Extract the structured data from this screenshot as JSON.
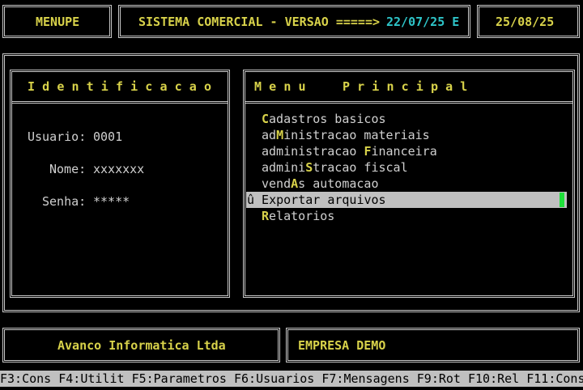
{
  "header": {
    "program": "MENUPE",
    "system_title": "SISTEMA COMERCIAL - VERSAO =====>",
    "version": "22/07/25 E",
    "date": "25/08/25"
  },
  "identification": {
    "title": "I d e n t i f i c a c a o",
    "user_label": "Usuario:",
    "user_value": "0001",
    "name_label": "Nome:",
    "name_value": "xxxxxxx",
    "password_label": "Senha:",
    "password_value": "*****"
  },
  "menu": {
    "title": "M e n u     P r i n c i p a l",
    "items": [
      {
        "pre": "",
        "hot": "C",
        "post": "adastros basicos"
      },
      {
        "pre": "ad",
        "hot": "M",
        "post": "inistracao materiais"
      },
      {
        "pre": "administracao ",
        "hot": "F",
        "post": "inanceira"
      },
      {
        "pre": "admini",
        "hot": "S",
        "post": "tracao fiscal"
      },
      {
        "pre": "vend",
        "hot": "A",
        "post": "s automacao"
      },
      {
        "label": "û Exportar arquivos"
      },
      {
        "pre": "",
        "hot": "R",
        "post": "elatorios"
      }
    ]
  },
  "footer": {
    "company": "Avanco Informatica Ltda",
    "enterprise": "EMPRESA DEMO"
  },
  "fkeys": [
    "F3:Cons",
    "F4:Utilit",
    "F5:Parametros",
    "F6:Usuarios",
    "F7:Mensagens",
    "F9:Rot",
    "F10:Rel",
    "F11:Cons"
  ],
  "colors": {
    "highlight_text": "#d8d24a",
    "version_text": "#2ec4c8",
    "selection_bg": "#c0c0c0",
    "cursor": "#1ee03a"
  }
}
